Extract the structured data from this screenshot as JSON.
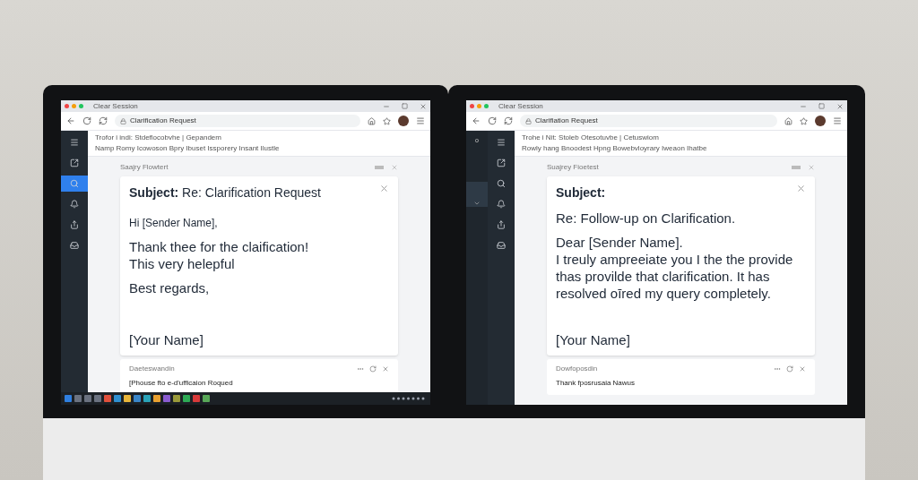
{
  "monitors": [
    {
      "window_title": "Clear Session",
      "address": "Clarification Request",
      "sidebar_items": [
        {
          "selected": false
        },
        {
          "selected": false
        },
        {
          "selected": true
        },
        {
          "selected": false
        },
        {
          "selected": false
        },
        {
          "selected": false
        }
      ],
      "header_lines": [
        "Trofor i indi: Stdeflocobvhe | Gepandem",
        "Namp Romy Icowoson Bpry Ibuset Issporery Insant Ilustle"
      ],
      "panel_title": "Saajry Flowtert",
      "email": {
        "subject": "**Subject:** Re: Clarification Request",
        "paragraphs": [
          {
            "kind": "small",
            "lines": [
              "Hi [Sender Name],"
            ]
          },
          {
            "kind": "large",
            "lines": [
              "Thank thee for the claification!",
              "This very helepful"
            ]
          },
          {
            "kind": "large",
            "lines": [
              "Best regards,"
            ]
          },
          {
            "kind": "large",
            "lines": [
              "[Your Name]"
            ]
          }
        ]
      },
      "second_card": {
        "title": "Daeteswandin",
        "preview": "[Phouse fto e-d'ufficaion Roqued"
      },
      "taskbar_icons": [
        {
          "color": "#2f7fe0"
        },
        {
          "color": "#6b7280"
        },
        {
          "color": "#6b7280"
        },
        {
          "color": "#6b7280"
        },
        {
          "color": "#e0503c"
        },
        {
          "color": "#2f8fd0"
        },
        {
          "color": "#e8b53a"
        },
        {
          "color": "#3a86c8"
        },
        {
          "color": "#2aa3b8"
        },
        {
          "color": "#e8a030"
        },
        {
          "color": "#8a5cd0"
        },
        {
          "color": "#9a9a3a"
        },
        {
          "color": "#2eaa55"
        },
        {
          "color": "#d83a3a"
        },
        {
          "color": "#58a858"
        }
      ]
    },
    {
      "window_title": "Clear Session",
      "address": "Clarifiation Request",
      "outer_sidebar": {
        "label": "o",
        "selected": true
      },
      "sidebar_items": [
        {
          "selected": false
        },
        {
          "selected": false
        },
        {
          "selected": false
        },
        {
          "selected": false
        },
        {
          "selected": false
        },
        {
          "selected": false
        }
      ],
      "header_lines": [
        "Trohe i Nit: Stoleb Otesotuvbe | Cetuswiom",
        "Rowly hang Bnoodest Hpng Bowebvloyrary Iweaon Ihatbe"
      ],
      "panel_title": "Suajrey Fioetest",
      "email": {
        "subject": "**Subject:**",
        "paragraphs": [
          {
            "kind": "large",
            "lines": [
              "Re: Follow-up on Clarification."
            ]
          },
          {
            "kind": "large",
            "lines": [
              "Dear [Sender Name].",
              "I treuly ampreeiate you I the the provide",
              "thas provilde that clarification. It has",
              "resolved oīred my query completely."
            ]
          },
          {
            "kind": "large",
            "lines": [
              "[Your Name]"
            ]
          }
        ]
      },
      "second_card": {
        "title": "Dowfoposdin",
        "preview": "Thank fposrusaia Nawus"
      }
    }
  ]
}
